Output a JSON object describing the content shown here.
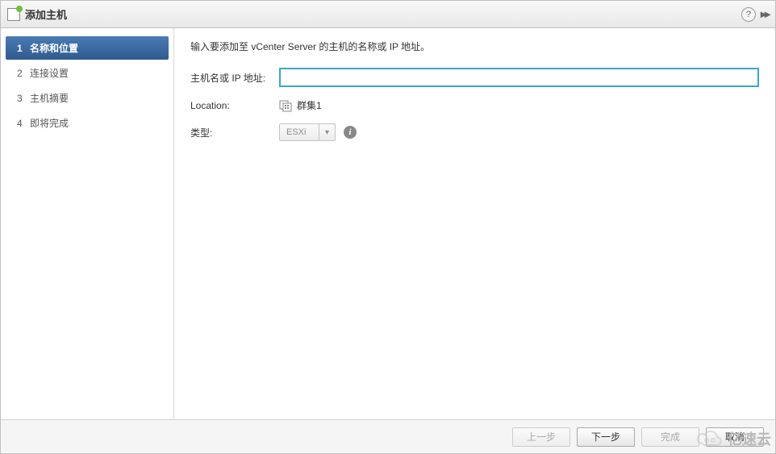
{
  "dialog": {
    "title": "添加主机"
  },
  "sidebar": {
    "steps": [
      {
        "num": "1",
        "label": "名称和位置"
      },
      {
        "num": "2",
        "label": "连接设置"
      },
      {
        "num": "3",
        "label": "主机摘要"
      },
      {
        "num": "4",
        "label": "即将完成"
      }
    ]
  },
  "content": {
    "instruction": "输入要添加至 vCenter Server 的主机的名称或 IP 地址。",
    "hostname_label": "主机名或 IP 地址:",
    "hostname_value": "",
    "location_label": "Location:",
    "location_value": "群集1",
    "type_label": "类型:",
    "type_value": "ESXi"
  },
  "footer": {
    "back": "上一步",
    "next": "下一步",
    "finish": "完成",
    "cancel": "取消"
  },
  "watermark": {
    "text": "亿速云"
  }
}
